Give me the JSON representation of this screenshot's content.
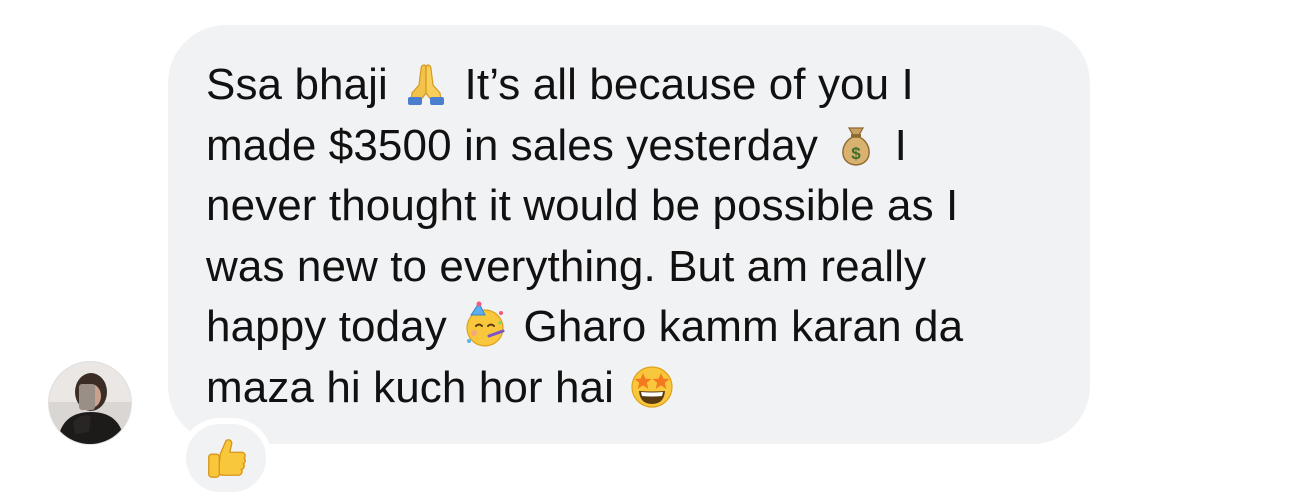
{
  "message": {
    "sender_avatar": "avatar-photo",
    "lines": [
      [
        "Ssa bhaji ",
        "",
        " It’s all because of you I"
      ],
      [
        "made $3500 in sales yesterday ",
        "",
        " I"
      ],
      [
        "never thought it would be possible as I"
      ],
      [
        "was new to everything. But am really"
      ],
      [
        "happy today ",
        "",
        " Gharo kamm karan da"
      ],
      [
        "maza hi kuch hor hai ",
        ""
      ]
    ],
    "emojis": [
      "folded-hands-icon",
      "money-bag-icon",
      "partying-face-icon",
      "star-struck-icon"
    ],
    "bubble_color": "#f1f2f4",
    "text_color": "#111111"
  },
  "reaction": {
    "icon": "thumbs-up-icon"
  }
}
